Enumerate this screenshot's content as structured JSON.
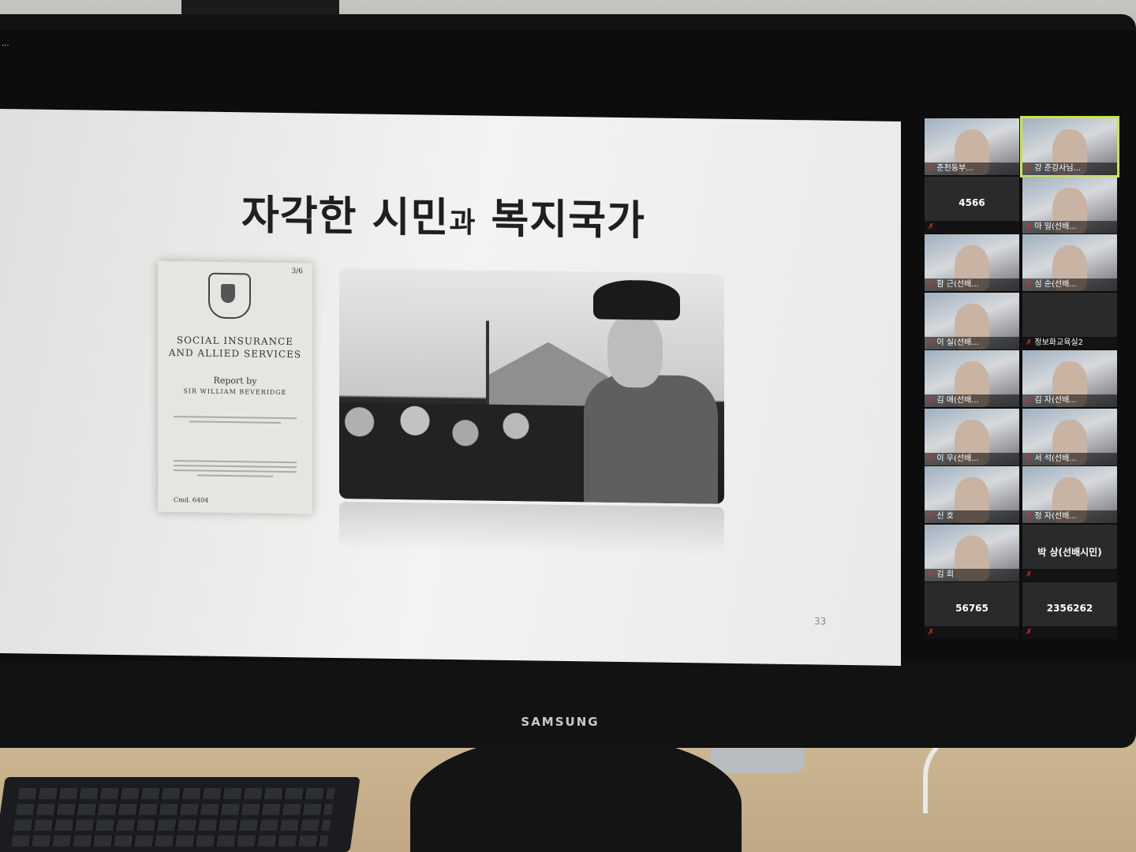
{
  "monitor": {
    "brand": "SAMSUNG",
    "corner_text": "..."
  },
  "slide": {
    "title_main_1": "자각한 시민",
    "title_connector": "과",
    "title_main_2": "복지국가",
    "page_number": "33",
    "document": {
      "price": "3/6",
      "line1": "SOCIAL INSURANCE",
      "line2": "AND ALLIED SERVICES",
      "report_by": "Report by",
      "author": "SIR WILLIAM BEVERIDGE",
      "cmd": "Cmd. 6404"
    }
  },
  "gallery": {
    "mute_icon": "muted-mic-icon",
    "highlight_color": "#c9e44a",
    "tiles": [
      {
        "label": "춘천동부...",
        "type": "video"
      },
      {
        "label": "강 준강사님...",
        "type": "video",
        "active": true
      },
      {
        "label": "",
        "type": "text",
        "center": "4566"
      },
      {
        "label": "마 일(선배...",
        "type": "video"
      },
      {
        "label": "함 근(선배...",
        "type": "video"
      },
      {
        "label": "심 순(선배...",
        "type": "video"
      },
      {
        "label": "이 실(선배...",
        "type": "video"
      },
      {
        "label": "정보화교육실2",
        "type": "text",
        "center": ""
      },
      {
        "label": "김 애(선배...",
        "type": "video"
      },
      {
        "label": "김 자(선배...",
        "type": "video"
      },
      {
        "label": "이 우(선배...",
        "type": "video"
      },
      {
        "label": "서 석(선배...",
        "type": "video"
      },
      {
        "label": "신 호",
        "type": "video"
      },
      {
        "label": "정 자(선배...",
        "type": "video"
      },
      {
        "label": "김 희",
        "type": "video"
      },
      {
        "label": "",
        "type": "text",
        "center": "박 상(선배시민)"
      },
      {
        "label": "",
        "type": "text",
        "center": "56765"
      },
      {
        "label": "",
        "type": "text",
        "center": "2356262"
      }
    ]
  }
}
